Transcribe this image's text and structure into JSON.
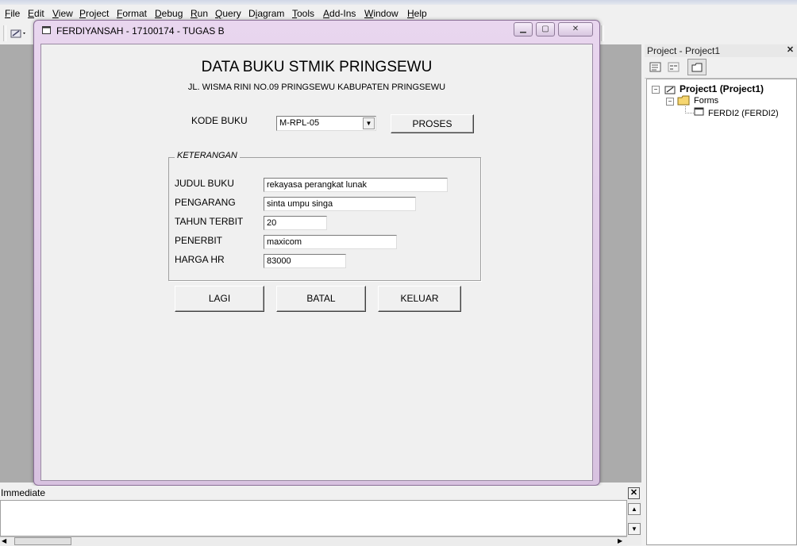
{
  "menu": {
    "items": [
      {
        "label": "File",
        "u": "F",
        "rest": "ile"
      },
      {
        "label": "Edit",
        "u": "E",
        "rest": "dit"
      },
      {
        "label": "View",
        "u": "V",
        "rest": "iew"
      },
      {
        "label": "Project",
        "u": "P",
        "rest": "roject"
      },
      {
        "label": "Format",
        "u": "F",
        "rest": "ormat"
      },
      {
        "label": "Debug",
        "u": "D",
        "rest": "ebug"
      },
      {
        "label": "Run",
        "u": "R",
        "rest": "un"
      },
      {
        "label": "Query",
        "u": "Q",
        "rest": "uery"
      },
      {
        "label": "Diagram",
        "u": "i",
        "pre": "D",
        "rest": "agram"
      },
      {
        "label": "Tools",
        "u": "T",
        "rest": "ools"
      },
      {
        "label": "Add-Ins",
        "u": "A",
        "rest": "dd-Ins"
      },
      {
        "label": "Window",
        "u": "W",
        "rest": "indow"
      },
      {
        "label": "Help",
        "u": "H",
        "rest": "elp"
      }
    ]
  },
  "form": {
    "window_title": "FERDIYANSAH - 17100174 - TUGAS B",
    "heading": "DATA BUKU STMIK PRINGSEWU",
    "subheading": "JL. WISMA RINI NO.09 PRINGSEWU KABUPATEN PRINGSEWU",
    "kode_label": "KODE BUKU",
    "kode_value": "M-RPL-05",
    "proses_label": "PROSES",
    "frame_caption": "KETERANGAN",
    "fields": {
      "judul_label": "JUDUL BUKU",
      "judul_value": "rekayasa perangkat lunak",
      "pengarang_label": "PENGARANG",
      "pengarang_value": "sinta umpu singa",
      "tahun_label": "TAHUN TERBIT",
      "tahun_value": "20",
      "penerbit_label": "PENERBIT",
      "penerbit_value": "maxicom",
      "harga_label": "HARGA HR",
      "harga_value": "83000"
    },
    "buttons": {
      "lagi": "LAGI",
      "batal": "BATAL",
      "keluar": "KELUAR"
    }
  },
  "immediate": {
    "title": "Immediate"
  },
  "project": {
    "title": "Project - Project1",
    "root": "Project1 (Project1)",
    "folder": "Forms",
    "item": "FERDI2 (FERDI2)"
  }
}
